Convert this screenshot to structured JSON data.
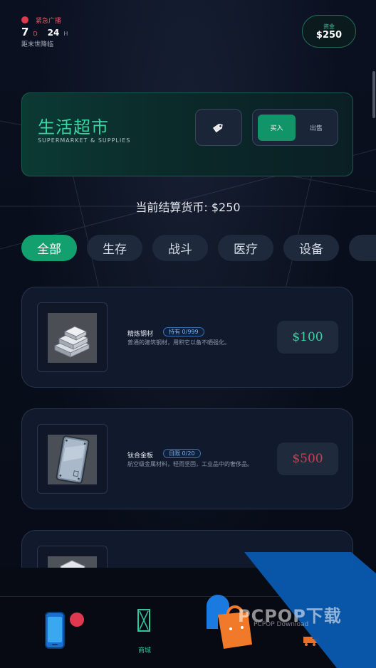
{
  "status": {
    "alert_text": "紧急广播",
    "days": "7",
    "days_unit": "D",
    "hours": "24",
    "hours_unit": "H",
    "subtitle": "距末世降临"
  },
  "wallet": {
    "label": "资金",
    "amount": "$250"
  },
  "shop": {
    "title": "生活超市",
    "subtitle": "SUPERMARKET & SUPPLIES",
    "buy_label": "买入",
    "sell_label": "出售",
    "currency_line": "当前结算货币: $250"
  },
  "tabs": [
    {
      "label": "全部",
      "active": true
    },
    {
      "label": "生存",
      "active": false
    },
    {
      "label": "战斗",
      "active": false
    },
    {
      "label": "医疗",
      "active": false
    },
    {
      "label": "设备",
      "active": false
    }
  ],
  "items": [
    {
      "name": "精炼钢材",
      "badge": "持有 0/999",
      "desc": "普通的建筑钢材，用积它以备不晒强化。",
      "price": "$100",
      "price_color": "#3ed2a2"
    },
    {
      "name": "钛合金板",
      "badge": "日限 0/20",
      "desc": "航空级金属材料，轻而坚固，工业品中的奢侈品。",
      "price": "$500",
      "price_color": "#c9404f"
    }
  ],
  "nav": {
    "shop_label": "商城"
  },
  "watermark": {
    "text": "PCPOP下载",
    "sub": "PCPOP Download"
  },
  "colors": {
    "accent": "#13a06f",
    "alert": "#e0384f",
    "background": "#080d1a"
  }
}
